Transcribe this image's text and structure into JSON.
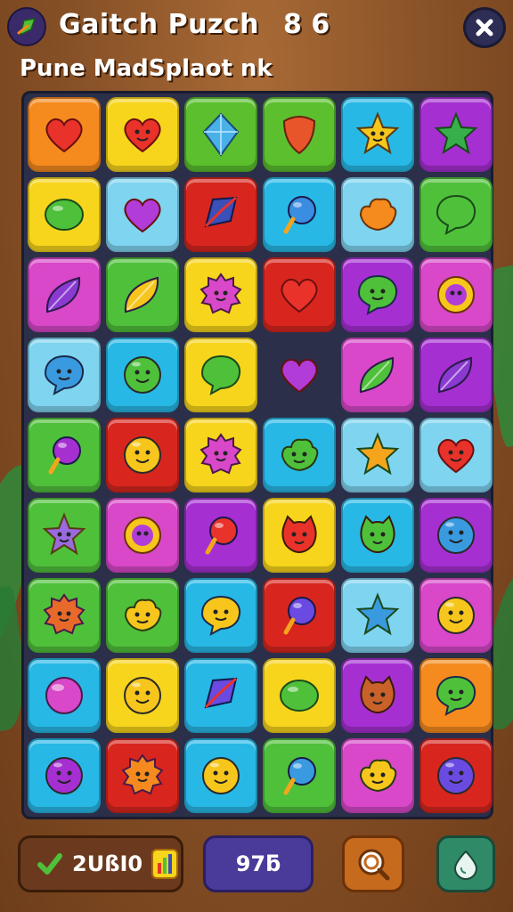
{
  "header": {
    "title": "Gaitch Puzch",
    "score": "8 6",
    "subtitle": "Pune MadSplaot nk"
  },
  "icons": {
    "logo": "leaf-flag-icon",
    "close": "close-icon"
  },
  "board": {
    "rows": 9,
    "cols": 6,
    "tiles": [
      [
        {
          "bg": "#f58a1e",
          "icon": "heart",
          "ic": "#e8322a"
        },
        {
          "bg": "#f7d51c",
          "icon": "heart-face",
          "ic": "#e8322a"
        },
        {
          "bg": "#5bbf2e",
          "icon": "diamond",
          "ic": "#4ab0e8"
        },
        {
          "bg": "#5bbf2e",
          "icon": "shield",
          "ic": "#e8552a"
        },
        {
          "bg": "#27b8e6",
          "icon": "star-face",
          "ic": "#f7c61c"
        },
        {
          "bg": "#a52fd1",
          "icon": "star",
          "ic": "#37b04a"
        }
      ],
      [
        {
          "bg": "#f7d51c",
          "icon": "blob",
          "ic": "#4fc03a"
        },
        {
          "bg": "#7fd4f0",
          "icon": "heart",
          "ic": "#b23cd8"
        },
        {
          "bg": "#d8261e",
          "icon": "gem",
          "ic": "#3a4fb8"
        },
        {
          "bg": "#27b8e6",
          "icon": "pop",
          "ic": "#3a8de0"
        },
        {
          "bg": "#7fd4f0",
          "icon": "cloud",
          "ic": "#f58a1e"
        },
        {
          "bg": "#4fc03a",
          "icon": "bubble",
          "ic": "#4fc03a"
        }
      ],
      [
        {
          "bg": "#d848c8",
          "icon": "leaf",
          "ic": "#8a3ad0"
        },
        {
          "bg": "#4fc03a",
          "icon": "leaf",
          "ic": "#f7c61c"
        },
        {
          "bg": "#f7d51c",
          "icon": "gear-face",
          "ic": "#d848c8"
        },
        {
          "bg": "#d8261e",
          "icon": "heart",
          "ic": "#e8322a"
        },
        {
          "bg": "#a52fd1",
          "icon": "bubble-face",
          "ic": "#4fc03a"
        },
        {
          "bg": "#d848c8",
          "icon": "flower-face",
          "ic": "#f7c61c"
        }
      ],
      [
        {
          "bg": "#7fd4f0",
          "icon": "bubble-face",
          "ic": "#3a9ae0"
        },
        {
          "bg": "#27b8e6",
          "icon": "face",
          "ic": "#4fc03a"
        },
        {
          "bg": "#f7d51c",
          "icon": "bubble",
          "ic": "#4fc03a"
        },
        {
          "bg": "empty",
          "icon": "heart",
          "ic": "#b23cd8"
        },
        {
          "bg": "#d848c8",
          "icon": "leaf",
          "ic": "#4fc03a"
        },
        {
          "bg": "#a52fd1",
          "icon": "leaf",
          "ic": "#8a3ad0"
        }
      ],
      [
        {
          "bg": "#4fc03a",
          "icon": "pop",
          "ic": "#a52fd1"
        },
        {
          "bg": "#d8261e",
          "icon": "face",
          "ic": "#f7c61c"
        },
        {
          "bg": "#f7d51c",
          "icon": "gear-face",
          "ic": "#d848c8"
        },
        {
          "bg": "#27b8e6",
          "icon": "cloud-face",
          "ic": "#4fc03a"
        },
        {
          "bg": "#7fd4f0",
          "icon": "star",
          "ic": "#f5a51c"
        },
        {
          "bg": "#7fd4f0",
          "icon": "heart-face",
          "ic": "#e8322a"
        }
      ],
      [
        {
          "bg": "#4fc03a",
          "icon": "star-face",
          "ic": "#9a6ae0"
        },
        {
          "bg": "#d848c8",
          "icon": "flower-face",
          "ic": "#f7c61c"
        },
        {
          "bg": "#a52fd1",
          "icon": "pop",
          "ic": "#e8322a"
        },
        {
          "bg": "#f7d51c",
          "icon": "cat-face",
          "ic": "#e8322a"
        },
        {
          "bg": "#27b8e6",
          "icon": "cat-face",
          "ic": "#4fc03a"
        },
        {
          "bg": "#a52fd1",
          "icon": "face",
          "ic": "#3a9ae0"
        }
      ],
      [
        {
          "bg": "#4fc03a",
          "icon": "gear-face",
          "ic": "#e86a2a"
        },
        {
          "bg": "#4fc03a",
          "icon": "cloud-face",
          "ic": "#f7c61c"
        },
        {
          "bg": "#27b8e6",
          "icon": "bubble-face",
          "ic": "#f7c61c"
        },
        {
          "bg": "#d8261e",
          "icon": "pop",
          "ic": "#6a4ae0"
        },
        {
          "bg": "#7fd4f0",
          "icon": "star",
          "ic": "#3a9ae0"
        },
        {
          "bg": "#d848c8",
          "icon": "face",
          "ic": "#f7c61c"
        }
      ],
      [
        {
          "bg": "#27b8e6",
          "icon": "ball",
          "ic": "#d848c8"
        },
        {
          "bg": "#f7d51c",
          "icon": "face",
          "ic": "#f7c61c"
        },
        {
          "bg": "#27b8e6",
          "icon": "gem",
          "ic": "#6a4ae0"
        },
        {
          "bg": "#f7d51c",
          "icon": "blob",
          "ic": "#4fc03a"
        },
        {
          "bg": "#a52fd1",
          "icon": "cat-face",
          "ic": "#c8622a"
        },
        {
          "bg": "#f58a1e",
          "icon": "bubble-face",
          "ic": "#4fc03a"
        }
      ],
      [
        {
          "bg": "#27b8e6",
          "icon": "face",
          "ic": "#a52fd1"
        },
        {
          "bg": "#d8261e",
          "icon": "gear-face",
          "ic": "#f58a1e"
        },
        {
          "bg": "#27b8e6",
          "icon": "face",
          "ic": "#f7c61c"
        },
        {
          "bg": "#4fc03a",
          "icon": "pop",
          "ic": "#3a9ae0"
        },
        {
          "bg": "#d848c8",
          "icon": "cloud-face",
          "ic": "#f7c61c"
        },
        {
          "bg": "#d8261e",
          "icon": "face",
          "ic": "#6a4ae0"
        }
      ]
    ]
  },
  "bottom_bar": {
    "left_value": "2UßI0",
    "middle_value": "97ƃ",
    "left_icon": "check-icon",
    "chart_icon": "bar-chart-icon",
    "search_icon": "search-icon",
    "drop_icon": "drop-icon"
  },
  "colors": {
    "brown": "#6b3a1e",
    "board": "#2b2f4a",
    "purple_button": "#4a3a9a",
    "orange_button": "#c66a1e",
    "green_button": "#2f8a68"
  }
}
